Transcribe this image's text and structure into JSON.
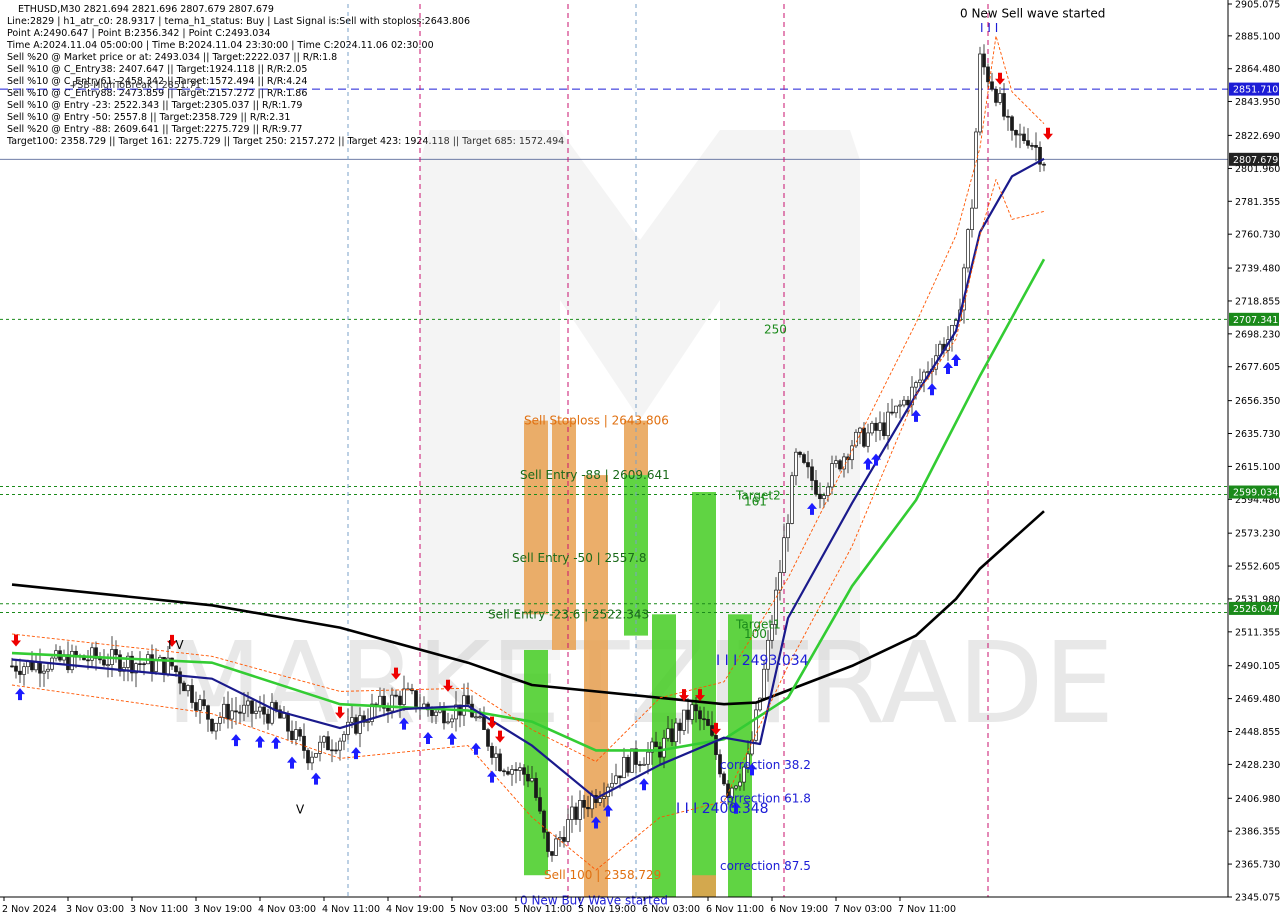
{
  "header": {
    "symbol_line": "ETHUSD,M30  2821.694 2821.696 2807.679 2807.679",
    "lines": [
      "Line:2829 | h1_atr_c0: 28.9317 | tema_h1_status: Buy | Last Signal is:Sell with stoploss:2643.806",
      "Point A:2490.647 | Point B:2356.342 | Point C:2493.034",
      "Time A:2024.11.04 05:00:00 | Time B:2024.11.04 23:30:00 | Time C:2024.11.06 02:30:00",
      "Sell %20 @ Market price or at: 2493.034 || Target:2222.037 || R/R:1.8",
      "Sell %10 @ C_Entry38: 2407.647 || Target:1924.118 || R/R:2.05",
      "Sell %10 @ C_Entry61: 2458.342 || Target:1572.494 || R/R:4.24",
      "Sell %10 @ C_Entry88: 2473.859 || Target:2157.272 || R/R:1.86",
      "Sell %10 @ Entry -23: 2522.343 || Target:2305.037 || R/R:1.79",
      "Sell %10 @ Entry -50: 2557.8 || Target:2358.729 || R/R:2.31",
      "Sell %20 @ Entry -88: 2609.641 || Target:2275.729 || R/R:9.77",
      "Target100: 2358.729 || Target 161: 2275.729 || Target 250: 2157.272 || Target 423: 1924.118 || Target 685: 1572.494"
    ],
    "overlap_text": "FSB-HighToBreak | 2851.71"
  },
  "chart_data": {
    "type": "candlestick",
    "symbol": "ETHUSD",
    "timeframe": "M30",
    "ylim": [
      2345.075,
      2905.075
    ],
    "y_ticks": [
      2905.075,
      2885.1,
      2864.48,
      2843.95,
      2822.69,
      2801.96,
      2781.355,
      2760.73,
      2739.48,
      2718.855,
      2698.23,
      2677.605,
      2656.35,
      2635.73,
      2615.1,
      2594.48,
      2573.23,
      2552.605,
      2531.98,
      2511.355,
      2490.105,
      2469.48,
      2448.855,
      2428.23,
      2406.98,
      2386.355,
      2365.73,
      2345.075
    ],
    "x_labels": [
      "2 Nov 2024",
      "3 Nov 03:00",
      "3 Nov 11:00",
      "3 Nov 19:00",
      "4 Nov 03:00",
      "4 Nov 11:00",
      "4 Nov 19:00",
      "5 Nov 03:00",
      "5 Nov 11:00",
      "5 Nov 19:00",
      "6 Nov 03:00",
      "6 Nov 11:00",
      "6 Nov 19:00",
      "7 Nov 03:00",
      "7 Nov 11:00"
    ],
    "price_labels": [
      {
        "value": 2851.71,
        "text": "2851.710",
        "bg": "#1c1cd6"
      },
      {
        "value": 2807.679,
        "text": "2807.679",
        "bg": "#222222"
      },
      {
        "value": 2707.341,
        "text": "2707.341",
        "bg": "#1a8a1a"
      },
      {
        "value": 2599.034,
        "text": "2599.034",
        "bg": "#1a8a1a"
      },
      {
        "value": 2526.047,
        "text": "2526.047",
        "bg": "#1a8a1a"
      }
    ],
    "hlines": [
      {
        "value": 2851.71,
        "color": "#1c1cd6",
        "style": "dashed"
      },
      {
        "value": 2807.679,
        "color": "#5a6a9a",
        "style": "solid"
      },
      {
        "value": 2707.341,
        "color": "#1a8a1a",
        "style": "dotted"
      },
      {
        "value": 2602.5,
        "color": "#1a8a1a",
        "style": "dotted"
      },
      {
        "value": 2597.5,
        "color": "#1a8a1a",
        "style": "dotted"
      },
      {
        "value": 2529.0,
        "color": "#1a8a1a",
        "style": "dotted"
      },
      {
        "value": 2523.5,
        "color": "#1a8a1a",
        "style": "dotted"
      }
    ],
    "vlines": [
      "4 Nov 05:00",
      "4 Nov 23:30",
      "6 Nov 02:30",
      "7 Nov 04:00"
    ],
    "zones": [
      {
        "x0": "4 Nov 18:00",
        "x1": "4 Nov 21:00",
        "y0": 2522.343,
        "y1": 2643.806,
        "color": "#e8a050"
      },
      {
        "x0": "4 Nov 18:00",
        "x1": "4 Nov 21:00",
        "y0": 2358.729,
        "y1": 2500.0,
        "color": "#44cc22"
      },
      {
        "x0": "4 Nov 21:30",
        "x1": "5 Nov 00:30",
        "y0": 2500.0,
        "y1": 2643.806,
        "color": "#e8a050"
      },
      {
        "x0": "5 Nov 01:30",
        "x1": "5 Nov 04:30",
        "y0": 2345.075,
        "y1": 2609.641,
        "color": "#e8a050"
      },
      {
        "x0": "5 Nov 06:30",
        "x1": "5 Nov 09:30",
        "y0": 2609.641,
        "y1": 2643.806,
        "color": "#e8a050"
      },
      {
        "x0": "5 Nov 06:30",
        "x1": "5 Nov 09:30",
        "y0": 2509.0,
        "y1": 2609.641,
        "color": "#44cc22"
      },
      {
        "x0": "5 Nov 10:00",
        "x1": "5 Nov 13:00",
        "y0": 2345.075,
        "y1": 2522.343,
        "color": "#44cc22"
      },
      {
        "x0": "5 Nov 15:00",
        "x1": "5 Nov 18:00",
        "y0": 2345.075,
        "y1": 2599.034,
        "color": "#44cc22"
      },
      {
        "x0": "5 Nov 15:00",
        "x1": "5 Nov 18:00",
        "y0": 2345.075,
        "y1": 2358.729,
        "color": "#e8a050"
      },
      {
        "x0": "5 Nov 19:30",
        "x1": "5 Nov 22:30",
        "y0": 2345.075,
        "y1": 2522.343,
        "color": "#44cc22"
      }
    ],
    "labels": [
      {
        "text": "Sell Stoploss | 2643.806",
        "x": "4 Nov 18:00",
        "y": 2643.806,
        "color": "#e07010"
      },
      {
        "text": "Sell Entry -88 | 2609.641",
        "x": "4 Nov 17:30",
        "y": 2609.641,
        "color": "#1a6a1a"
      },
      {
        "text": "Sell Entry -50 | 2557.8",
        "x": "4 Nov 16:30",
        "y": 2557.8,
        "color": "#1a6a1a"
      },
      {
        "text": "Sell Entry -23.6 | 2522.343",
        "x": "4 Nov 13:30",
        "y": 2522.343,
        "color": "#1a6a1a"
      },
      {
        "text": "Sell 100 | 2358.729",
        "x": "4 Nov 20:30",
        "y": 2358.729,
        "color": "#e07010"
      },
      {
        "text": "0 New Buy Wave started",
        "x": "4 Nov 17:30",
        "y": 2343.0,
        "color": "#1c1cd6"
      },
      {
        "text": "0 New Sell wave started",
        "x": "7 Nov 00:30",
        "y": 2899.0,
        "color": "#000000"
      },
      {
        "text": "I I I",
        "x": "7 Nov 03:00",
        "y": 2890.0,
        "color": "#1c1cd6"
      },
      {
        "text": "I V",
        "x": "2 Nov 21:30",
        "y": 2503.0,
        "color": "#000000"
      },
      {
        "text": "V",
        "x": "3 Nov 13:30",
        "y": 2400.0,
        "color": "#000000"
      },
      {
        "text": "I I I 2493.034",
        "x": "5 Nov 18:00",
        "y": 2493.034,
        "color": "#1c1cd6"
      },
      {
        "text": "I I I 2400.348",
        "x": "5 Nov 13:00",
        "y": 2400.348,
        "color": "#1c1cd6"
      },
      {
        "text": "correction 38.2",
        "x": "5 Nov 18:30",
        "y": 2428.0,
        "color": "#1c1cd6"
      },
      {
        "text": "correction 61.8",
        "x": "5 Nov 18:30",
        "y": 2407.0,
        "color": "#1c1cd6"
      },
      {
        "text": "correction 87.5",
        "x": "5 Nov 18:30",
        "y": 2364.5,
        "color": "#1c1cd6"
      },
      {
        "text": "Target2",
        "x": "5 Nov 20:30",
        "y": 2597.0,
        "color": "#1a8a1a"
      },
      {
        "text": "161",
        "x": "5 Nov 21:30",
        "y": 2593.0,
        "color": "#1a8a1a"
      },
      {
        "text": "Target1",
        "x": "5 Nov 20:30",
        "y": 2516.0,
        "color": "#1a8a1a"
      },
      {
        "text": "100",
        "x": "5 Nov 21:30",
        "y": 2510.0,
        "color": "#1a8a1a"
      },
      {
        "text": "250",
        "x": "6 Nov 00:00",
        "y": 2701.0,
        "color": "#1a8a1a"
      }
    ],
    "series": [
      {
        "name": "ma_slow",
        "color": "#000000",
        "points": [
          [
            "2 Nov 02:00",
            2541
          ],
          [
            "3 Nov 03:00",
            2528
          ],
          [
            "3 Nov 19:00",
            2514
          ],
          [
            "4 Nov 11:00",
            2492
          ],
          [
            "4 Nov 19:00",
            2478
          ],
          [
            "5 Nov 11:00",
            2470
          ],
          [
            "5 Nov 19:00",
            2466
          ],
          [
            "5 Nov 23:00",
            2467
          ],
          [
            "6 Nov 11:00",
            2490
          ],
          [
            "6 Nov 19:00",
            2509
          ],
          [
            "7 Nov 00:00",
            2532
          ],
          [
            "7 Nov 03:00",
            2551
          ],
          [
            "7 Nov 11:00",
            2587
          ]
        ]
      },
      {
        "name": "ma_mid",
        "color": "#33cc33",
        "points": [
          [
            "2 Nov 02:00",
            2498
          ],
          [
            "3 Nov 03:00",
            2492
          ],
          [
            "3 Nov 19:00",
            2466
          ],
          [
            "4 Nov 11:00",
            2462
          ],
          [
            "4 Nov 19:00",
            2455
          ],
          [
            "5 Nov 03:00",
            2437
          ],
          [
            "5 Nov 11:00",
            2437
          ],
          [
            "5 Nov 19:00",
            2444
          ],
          [
            "6 Nov 03:00",
            2470
          ],
          [
            "6 Nov 11:00",
            2540
          ],
          [
            "6 Nov 19:00",
            2594
          ],
          [
            "7 Nov 03:00",
            2672
          ],
          [
            "7 Nov 11:00",
            2745
          ]
        ]
      },
      {
        "name": "ma_fast",
        "color": "#1a1a8c",
        "points": [
          [
            "2 Nov 02:00",
            2494
          ],
          [
            "3 Nov 03:00",
            2482
          ],
          [
            "3 Nov 11:00",
            2462
          ],
          [
            "3 Nov 19:00",
            2451
          ],
          [
            "4 Nov 03:00",
            2463
          ],
          [
            "4 Nov 11:00",
            2465
          ],
          [
            "4 Nov 19:00",
            2440
          ],
          [
            "5 Nov 03:00",
            2407
          ],
          [
            "5 Nov 11:00",
            2428
          ],
          [
            "5 Nov 19:00",
            2445
          ],
          [
            "5 Nov 23:30",
            2441
          ],
          [
            "6 Nov 03:00",
            2520
          ],
          [
            "6 Nov 11:00",
            2592
          ],
          [
            "6 Nov 19:00",
            2660
          ],
          [
            "7 Nov 00:00",
            2700
          ],
          [
            "7 Nov 03:00",
            2762
          ],
          [
            "7 Nov 07:00",
            2797
          ],
          [
            "7 Nov 11:00",
            2808
          ]
        ]
      },
      {
        "name": "band_upper",
        "color": "#ff5500",
        "style": "dashed",
        "points": [
          [
            "2 Nov 02:00",
            2510
          ],
          [
            "3 Nov 03:00",
            2496
          ],
          [
            "3 Nov 19:00",
            2474
          ],
          [
            "4 Nov 11:00",
            2476
          ],
          [
            "4 Nov 19:00",
            2450
          ],
          [
            "5 Nov 03:00",
            2430
          ],
          [
            "5 Nov 11:00",
            2470
          ],
          [
            "5 Nov 19:00",
            2480
          ],
          [
            "6 Nov 03:00",
            2545
          ],
          [
            "6 Nov 11:00",
            2625
          ],
          [
            "6 Nov 19:00",
            2705
          ],
          [
            "7 Nov 00:00",
            2760
          ],
          [
            "7 Nov 03:00",
            2815
          ],
          [
            "7 Nov 05:00",
            2885
          ],
          [
            "7 Nov 07:00",
            2850
          ],
          [
            "7 Nov 11:00",
            2830
          ]
        ]
      },
      {
        "name": "band_lower",
        "color": "#ff5500",
        "style": "dashed",
        "points": [
          [
            "2 Nov 02:00",
            2478
          ],
          [
            "3 Nov 03:00",
            2460
          ],
          [
            "3 Nov 19:00",
            2432
          ],
          [
            "4 Nov 11:00",
            2440
          ],
          [
            "4 Nov 19:00",
            2395
          ],
          [
            "5 Nov 03:00",
            2362
          ],
          [
            "5 Nov 11:00",
            2395
          ],
          [
            "5 Nov 19:00",
            2405
          ],
          [
            "6 Nov 03:00",
            2490
          ],
          [
            "6 Nov 11:00",
            2565
          ],
          [
            "6 Nov 19:00",
            2660
          ],
          [
            "7 Nov 00:00",
            2695
          ],
          [
            "7 Nov 03:00",
            2760
          ],
          [
            "7 Nov 05:00",
            2795
          ],
          [
            "7 Nov 07:00",
            2770
          ],
          [
            "7 Nov 11:00",
            2775
          ]
        ]
      }
    ],
    "close_path": [
      [
        "2 Nov 02:00",
        2490
      ],
      [
        "2 Nov 12:00",
        2495
      ],
      [
        "2 Nov 22:00",
        2490
      ],
      [
        "3 Nov 03:00",
        2455
      ],
      [
        "3 Nov 05:00",
        2462
      ],
      [
        "3 Nov 11:00",
        2460
      ],
      [
        "3 Nov 15:00",
        2435
      ],
      [
        "3 Nov 19:00",
        2445
      ],
      [
        "3 Nov 23:00",
        2462
      ],
      [
        "4 Nov 03:00",
        2472
      ],
      [
        "4 Nov 07:00",
        2460
      ],
      [
        "4 Nov 11:00",
        2465
      ],
      [
        "4 Nov 15:00",
        2430
      ],
      [
        "4 Nov 19:00",
        2420
      ],
      [
        "4 Nov 21:00",
        2370
      ],
      [
        "5 Nov 00:00",
        2395
      ],
      [
        "5 Nov 03:00",
        2410
      ],
      [
        "5 Nov 07:00",
        2430
      ],
      [
        "5 Nov 11:00",
        2438
      ],
      [
        "5 Nov 15:00",
        2462
      ],
      [
        "5 Nov 17:00",
        2450
      ],
      [
        "5 Nov 19:30",
        2412
      ],
      [
        "5 Nov 22:00",
        2430
      ],
      [
        "5 Nov 23:30",
        2470
      ],
      [
        "6 Nov 02:00",
        2550
      ],
      [
        "6 Nov 04:00",
        2620
      ],
      [
        "6 Nov 07:00",
        2600
      ],
      [
        "6 Nov 11:00",
        2630
      ],
      [
        "6 Nov 15:00",
        2640
      ],
      [
        "6 Nov 19:00",
        2665
      ],
      [
        "6 Nov 22:00",
        2690
      ],
      [
        "7 Nov 00:00",
        2700
      ],
      [
        "7 Nov 02:00",
        2780
      ],
      [
        "7 Nov 03:00",
        2870
      ],
      [
        "7 Nov 05:00",
        2850
      ],
      [
        "7 Nov 07:00",
        2820
      ],
      [
        "7 Nov 09:00",
        2822
      ],
      [
        "7 Nov 11:00",
        2808
      ]
    ],
    "signals": {
      "buy": [
        "2 Nov 03:00",
        "3 Nov 06:00",
        "3 Nov 09:00",
        "3 Nov 11:00",
        "3 Nov 13:00",
        "3 Nov 16:00",
        "3 Nov 21:00",
        "4 Nov 03:00",
        "4 Nov 06:00",
        "4 Nov 09:00",
        "4 Nov 12:00",
        "4 Nov 14:00",
        "5 Nov 03:00",
        "5 Nov 04:30",
        "5 Nov 09:00",
        "5 Nov 20:30",
        "5 Nov 22:30",
        "6 Nov 06:00",
        "6 Nov 13:00",
        "6 Nov 14:00",
        "6 Nov 19:00",
        "6 Nov 21:00",
        "6 Nov 23:00",
        "7 Nov 00:00"
      ],
      "sell": [
        "2 Nov 02:30",
        "2 Nov 22:00",
        "3 Nov 19:00",
        "4 Nov 02:00",
        "4 Nov 08:30",
        "4 Nov 14:00",
        "4 Nov 15:00",
        "5 Nov 14:00",
        "5 Nov 16:00",
        "5 Nov 18:00",
        "7 Nov 05:30",
        "7 Nov 11:30"
      ]
    }
  }
}
